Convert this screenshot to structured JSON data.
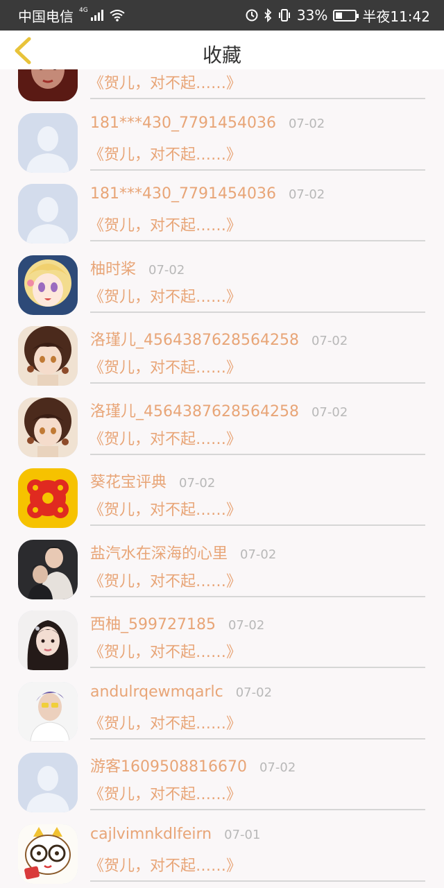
{
  "status_bar": {
    "carrier": "中国电信",
    "network": "4G",
    "battery": "33%",
    "battery_level": 0.33,
    "time": "半夜11:42"
  },
  "header": {
    "title": "收藏",
    "back_icon": "chevron-left-icon"
  },
  "colors": {
    "accent": "#e8a577",
    "date": "#b8b8b8",
    "back_icon": "#e8c33a",
    "divider": "#d6d6d6"
  },
  "items": [
    {
      "name": "",
      "date": "",
      "subtitle": "《贺儿，对不起……》",
      "avatar": "photo-red"
    },
    {
      "name": "181***430_7791454036",
      "date": "07-02",
      "subtitle": "《贺儿，对不起……》",
      "avatar": "default"
    },
    {
      "name": "181***430_7791454036",
      "date": "07-02",
      "subtitle": "《贺儿，对不起……》",
      "avatar": "default"
    },
    {
      "name": "柚时桨",
      "date": "07-02",
      "subtitle": "《贺儿，对不起……》",
      "avatar": "anime-blonde"
    },
    {
      "name": "洛瑾儿_4564387628564258",
      "date": "07-02",
      "subtitle": "《贺儿，对不起……》",
      "avatar": "anime-brown"
    },
    {
      "name": "洛瑾儿_4564387628564258",
      "date": "07-02",
      "subtitle": "《贺儿，对不起……》",
      "avatar": "anime-brown"
    },
    {
      "name": "葵花宝评典",
      "date": "07-02",
      "subtitle": "《贺儿，对不起……》",
      "avatar": "flower-red"
    },
    {
      "name": "盐汽水在深海的心里",
      "date": "07-02",
      "subtitle": "《贺儿，对不起……》",
      "avatar": "photo-couple"
    },
    {
      "name": "西柚_599727185",
      "date": "07-02",
      "subtitle": "《贺儿，对不起……》",
      "avatar": "photo-girl"
    },
    {
      "name": "andulrqewmqarlc",
      "date": "07-02",
      "subtitle": "《贺儿，对不起……》",
      "avatar": "photo-boy"
    },
    {
      "name": "游客1609508816670",
      "date": "07-02",
      "subtitle": "《贺儿，对不起……》",
      "avatar": "default"
    },
    {
      "name": "cajlvimnkdlfeirn",
      "date": "07-01",
      "subtitle": "《贺儿，对不起……》",
      "avatar": "cartoon"
    }
  ]
}
